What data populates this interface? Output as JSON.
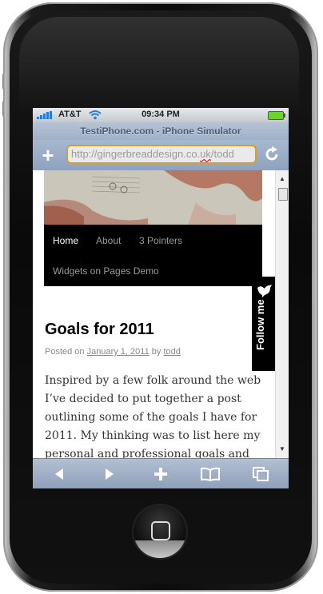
{
  "status": {
    "carrier": "AT&T",
    "time": "09:34 PM"
  },
  "simulator_title": "TestiPhone.com - iPhone Simulator",
  "address": {
    "url_prefix": "http://gingerbreaddesign.co.",
    "url_underlined": "uk",
    "url_suffix": "/todd"
  },
  "nav": {
    "items": [
      "Home",
      "About",
      "3 Pointers",
      "Widgets on Pages Demo"
    ]
  },
  "follow": {
    "label": "Follow me"
  },
  "post": {
    "title": "Goals for 2011",
    "posted_on": "Posted on",
    "date": "January 1, 2011",
    "by": "by",
    "author": "todd",
    "body": "Inspired by a few folk around the web I’ve decided to put together a post outlining some of the goals I have for 2011. My thinking was to list here my personal and professional goals and"
  },
  "icons": [
    "wifi-icon",
    "battery-icon",
    "plus-icon",
    "reload-icon",
    "back-arrow-icon",
    "forward-arrow-icon",
    "add-bookmark-icon",
    "bookmarks-icon",
    "pages-icon",
    "bird-icon"
  ]
}
